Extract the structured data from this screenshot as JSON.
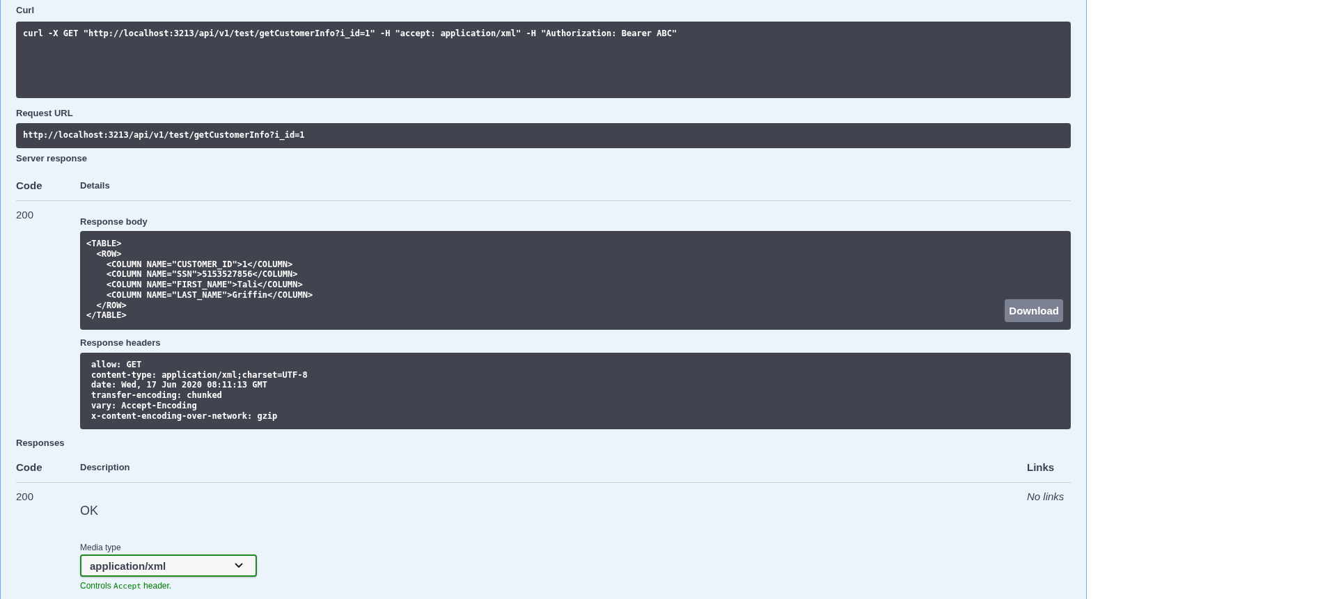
{
  "curl": {
    "label": "Curl",
    "command": "curl -X GET \"http://localhost:3213/api/v1/test/getCustomerInfo?i_id=1\" -H \"accept: application/xml\" -H \"Authorization: Bearer ABC\""
  },
  "request_url": {
    "label": "Request URL",
    "url": "http://localhost:3213/api/v1/test/getCustomerInfo?i_id=1"
  },
  "server_response": {
    "label": "Server response",
    "columns": [
      {
        "label": "Code",
        "kind": "code"
      },
      {
        "label": "Details",
        "kind": "details"
      }
    ],
    "code": "200",
    "response_body": {
      "label": "Response body",
      "content": "<TABLE>\n  <ROW>\n    <COLUMN NAME=\"CUSTOMER_ID\">1</COLUMN>\n    <COLUMN NAME=\"SSN\">5153527856</COLUMN>\n    <COLUMN NAME=\"FIRST_NAME\">Tali</COLUMN>\n    <COLUMN NAME=\"LAST_NAME\">Griffin</COLUMN>\n  </ROW>\n</TABLE>",
      "download_button": "Download"
    },
    "response_headers": {
      "label": "Response headers",
      "lines": [
        "allow: GET",
        "content-type: application/xml;charset=UTF-8",
        "date: Wed, 17 Jun 2020 08:11:13 GMT",
        "transfer-encoding: chunked",
        "vary: Accept-Encoding",
        "x-content-encoding-over-network: gzip"
      ]
    }
  },
  "responses": {
    "label": "Responses",
    "columns": [
      {
        "label": "Code",
        "kind": "code"
      },
      {
        "label": "Description",
        "kind": "description"
      },
      {
        "label": "Links",
        "kind": "links"
      }
    ],
    "rows": [
      {
        "code": "200",
        "description": "OK",
        "media_type": {
          "label": "Media type",
          "value": "application/xml",
          "hint": {
            "before": "Controls",
            "code": "Accept",
            "after": "header."
          }
        },
        "links": "No links"
      }
    ]
  }
}
